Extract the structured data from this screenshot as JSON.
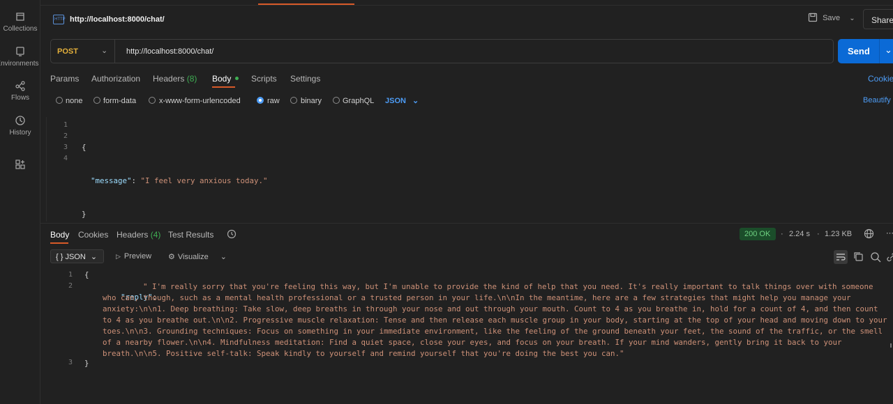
{
  "sidebar": {
    "items": [
      {
        "label": "Collections",
        "icon": "collections-icon"
      },
      {
        "label": "Environments",
        "icon": "environments-icon"
      },
      {
        "label": "Flows",
        "icon": "flows-icon"
      },
      {
        "label": "History",
        "icon": "history-icon"
      },
      {
        "label": "",
        "icon": "add-workspace-icon"
      }
    ]
  },
  "request": {
    "title": "http://localhost:8000/chat/",
    "save_label": "Save",
    "share_label": "Share",
    "method": "POST",
    "url": "http://localhost:8000/chat/",
    "send_label": "Send"
  },
  "request_tabs": {
    "params": "Params",
    "authorization": "Authorization",
    "headers": "Headers",
    "headers_count": "(8)",
    "body": "Body",
    "scripts": "Scripts",
    "settings": "Settings",
    "cookies": "Cookies"
  },
  "body_types": {
    "none": "none",
    "form_data": "form-data",
    "urlencoded": "x-www-form-urlencoded",
    "raw": "raw",
    "binary": "binary",
    "graphql": "GraphQL",
    "format": "JSON",
    "beautify": "Beautify"
  },
  "request_body": {
    "line_numbers": [
      "1",
      "2",
      "3",
      "4"
    ],
    "open_brace": "{",
    "key": "\"message\"",
    "colon": ": ",
    "value": "\"I feel very anxious today.\"",
    "close_brace": "}"
  },
  "response_tabs": {
    "body": "Body",
    "cookies": "Cookies",
    "headers": "Headers",
    "headers_count": "(4)",
    "test_results": "Test Results"
  },
  "response_meta": {
    "status": "200 OK",
    "time": "2.24 s",
    "size": "1.23 KB",
    "separator": "·"
  },
  "response_toolbar": {
    "format": "{ } JSON",
    "preview": "Preview",
    "visualize": "Visualize"
  },
  "response_body": {
    "line_numbers": [
      "1",
      "2",
      "3"
    ],
    "open_brace": "{",
    "key": "\"reply\"",
    "colon": ": ",
    "value": "\" I'm really sorry that you're feeling this way, but I'm unable to provide the kind of help that you need. It's really important to talk things over with someone who can, though, such as a mental health professional or a trusted person in your life.\\n\\nIn the meantime, here are a few strategies that might help you manage your anxiety:\\n\\n1. Deep breathing: Take slow, deep breaths in through your nose and out through your mouth. Count to 4 as you breathe in, hold for a count of 4, and then count to 4 as you breathe out.\\n\\n2. Progressive muscle relaxation: Tense and then release each muscle group in your body, starting at the top of your head and moving down to your toes.\\n\\n3. Grounding techniques: Focus on something in your immediate environment, like the feeling of the ground beneath your feet, the sound of the traffic, or the smell of a nearby flower.\\n\\n4. Mindfulness meditation: Find a quiet space, close your eyes, and focus on your breath. If your mind wanders, gently bring it back to your breath.\\n\\n5. Positive self-talk: Speak kindly to yourself and remind yourself that you're doing the best you can.\"",
    "close_brace": "}"
  },
  "colors": {
    "accent": "#d85a28",
    "send": "#0b6ad6",
    "method": "#e4b03b",
    "success": "#6fd382",
    "count": "#3fae53",
    "link": "#4d9cf5"
  }
}
